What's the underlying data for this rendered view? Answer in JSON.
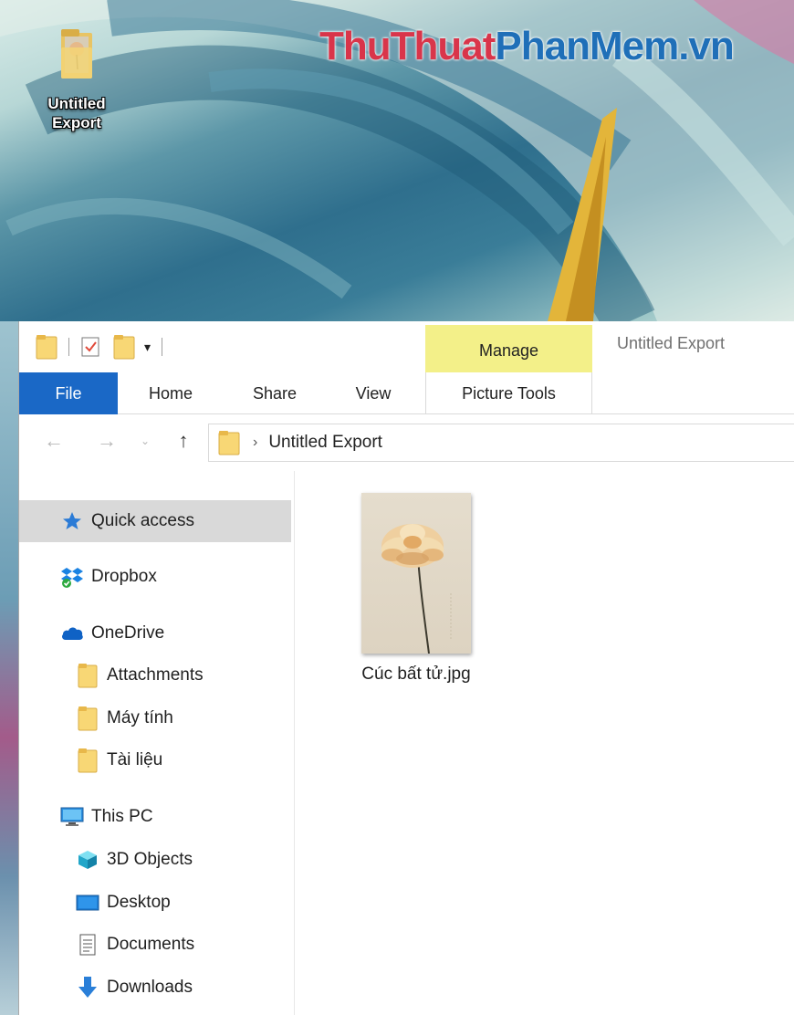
{
  "desktop": {
    "icon_label": "Untitled Export",
    "watermark_part1": "ThuThuat",
    "watermark_part2": "PhanMem.vn"
  },
  "window": {
    "title": "Untitled Export",
    "context_tab": "Manage",
    "qat_dropdown_glyph": "▾"
  },
  "ribbon": {
    "tabs": [
      {
        "label": "File"
      },
      {
        "label": "Home"
      },
      {
        "label": "Share"
      },
      {
        "label": "View"
      },
      {
        "label": "Picture Tools"
      }
    ]
  },
  "navbar": {
    "back": "←",
    "forward": "→",
    "recent": "⌄",
    "up": "↑",
    "chevron": "›",
    "path": "Untitled Export"
  },
  "navpane": {
    "items": [
      {
        "label": "Quick access",
        "icon": "star-icon",
        "selected": true
      },
      {
        "label": "Dropbox",
        "icon": "dropbox-icon"
      },
      {
        "label": "OneDrive",
        "icon": "onedrive-icon"
      },
      {
        "label": "Attachments",
        "icon": "folder-icon"
      },
      {
        "label": "Máy tính",
        "icon": "folder-icon"
      },
      {
        "label": "Tài liệu",
        "icon": "folder-icon"
      },
      {
        "label": "This PC",
        "icon": "pc-icon"
      },
      {
        "label": "3D Objects",
        "icon": "cube-icon"
      },
      {
        "label": "Desktop",
        "icon": "desktop-icon"
      },
      {
        "label": "Documents",
        "icon": "document-icon"
      },
      {
        "label": "Downloads",
        "icon": "download-icon"
      }
    ]
  },
  "content": {
    "files": [
      {
        "name": "Cúc bất tử.jpg",
        "type": "image-thumbnail"
      }
    ]
  },
  "colors": {
    "file_tab": "#1a68c6",
    "manage_tab": "#f3f089",
    "selected_item": "#d9d9d9",
    "folder_yellow": "#f8d775"
  }
}
